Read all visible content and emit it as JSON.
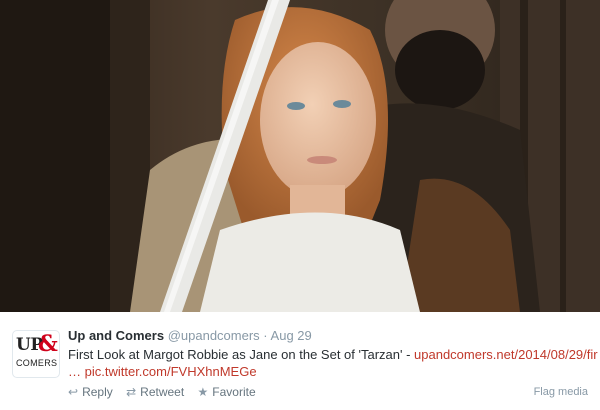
{
  "photo": {
    "description_icon": "photo-icon"
  },
  "tweet": {
    "avatar": {
      "logo_up": "UP",
      "logo_amp": "&",
      "logo_comers": "COMERS"
    },
    "display_name": "Up and Comers",
    "handle": "@upandcomers",
    "separator": "·",
    "date": "Aug 29",
    "text_main": "First Look at Margot Robbie as Jane on the Set of 'Tarzan' - ",
    "link_url": "upandcomers.net/2014/08/29/fir",
    "ellipsis": "… ",
    "pic_link": "pic.twitter.com/FVHXhnMEGe"
  },
  "actions": {
    "reply_icon": "reply-icon",
    "reply_label": "Reply",
    "retweet_icon": "retweet-icon",
    "retweet_label": "Retweet",
    "favorite_icon": "star-icon",
    "favorite_label": "Favorite",
    "flag_label": "Flag media"
  },
  "colors": {
    "link": "#c0392b",
    "muted": "#8899a6",
    "text": "#292f33",
    "logo_red": "#d0021b"
  }
}
